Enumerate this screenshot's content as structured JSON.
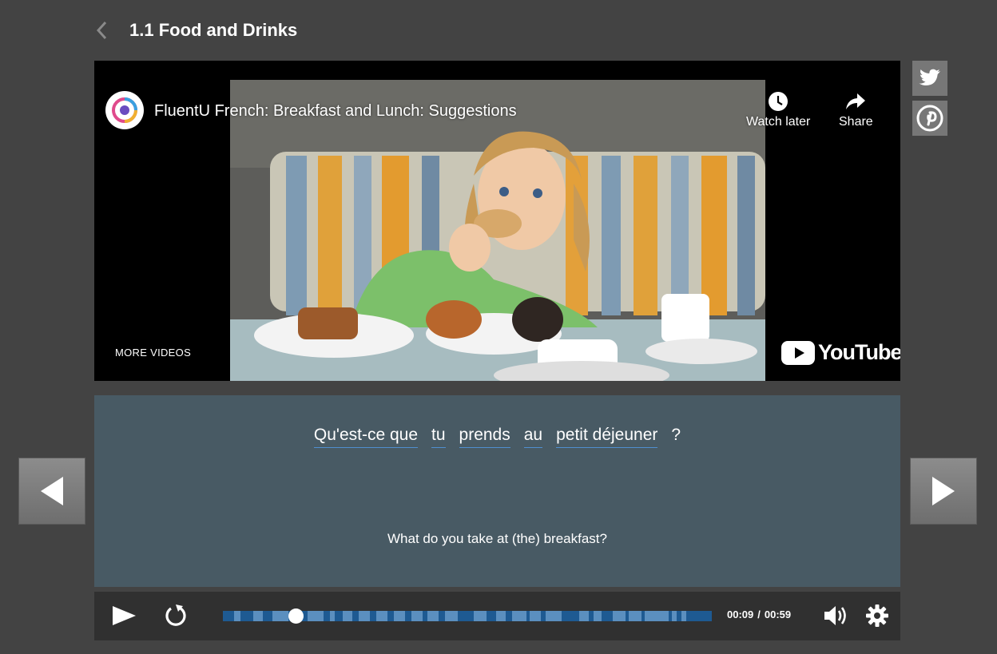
{
  "header": {
    "title": "1.1 Food and Drinks"
  },
  "video": {
    "title": "FluentU French: Breakfast and Lunch: Suggestions",
    "watch_later": "Watch later",
    "share": "Share",
    "more_videos": "MORE VIDEOS",
    "brand": "YouTube"
  },
  "subtitle": {
    "words": [
      "Qu'est-ce que",
      "tu",
      "prends",
      "au",
      "petit déjeuner"
    ],
    "punctuation": "?",
    "translation": "What do you take at (the) breakfast?"
  },
  "player": {
    "current_time": "00:09",
    "duration": "00:59",
    "time_separator": "/",
    "progress_fraction": 0.15
  },
  "colors": {
    "page_bg": "#434343",
    "panel_bg": "#485a64",
    "progress": "#1e5a92",
    "word_underline": "#4f8fd0"
  },
  "icons": [
    "back-chevron-icon",
    "twitter-icon",
    "pinterest-icon",
    "clock-icon",
    "share-arrow-icon",
    "play-icon",
    "replay-icon",
    "volume-icon",
    "gear-icon",
    "arrow-left-icon",
    "arrow-right-icon"
  ]
}
